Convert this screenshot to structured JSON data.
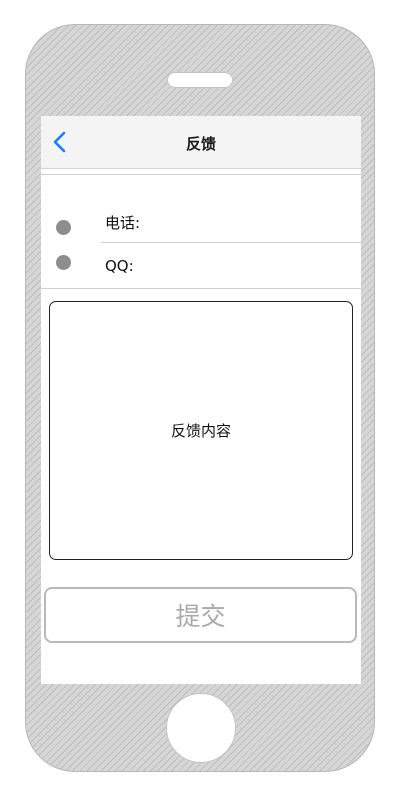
{
  "navbar": {
    "title": "反馈",
    "back_icon": "chevron-left-icon",
    "accent_color": "#1a7cf5"
  },
  "contact": {
    "rows": [
      {
        "label": "电话:"
      },
      {
        "label": "QQ:"
      }
    ]
  },
  "feedback": {
    "placeholder": "反馈内容"
  },
  "actions": {
    "submit_label": "提交"
  }
}
